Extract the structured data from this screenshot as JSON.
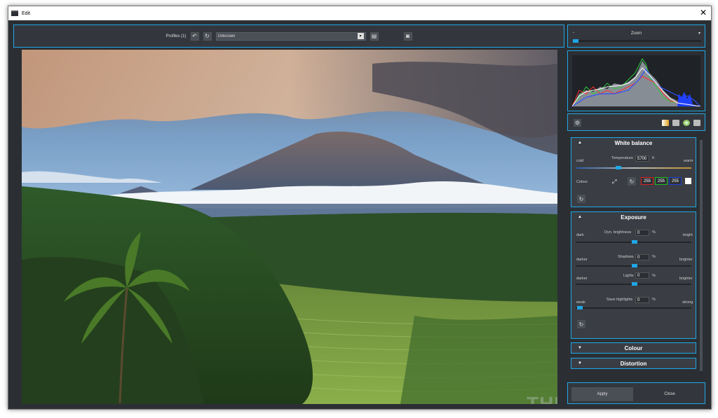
{
  "window": {
    "title": "Edit",
    "close": "✕"
  },
  "toolbar": {
    "profiles_label": "Profiles (1)",
    "undo": "↶",
    "reset": "↻",
    "profile_value": "Unknown",
    "dropdown_arrow": "▾",
    "save": "▤",
    "camera": "◙"
  },
  "zoom": {
    "label": "Zoom",
    "dash": "-",
    "arrow": "▾",
    "level": 0
  },
  "tools": {
    "gear": "⚙"
  },
  "white_balance": {
    "title": "White balance",
    "temperature_label": "Temperature",
    "temperature_value": "5700",
    "temperature_unit": "K",
    "cold": "cold",
    "warm": "warm",
    "colour_label": "Colour",
    "r": "255",
    "g": "255",
    "b": "255",
    "picker": "⤢",
    "reset": "↻"
  },
  "exposure": {
    "title": "Exposure",
    "dyn_label": "Dyn. brightness",
    "dyn_value": "0",
    "dyn_unit": "%",
    "dyn_left": "dark",
    "dyn_right": "bright",
    "shadows_label": "Shadows",
    "shadows_value": "0",
    "shadows_unit": "%",
    "shadows_left": "darker",
    "shadows_right": "brighter",
    "lights_label": "Lights",
    "lights_value": "0",
    "lights_unit": "%",
    "lights_left": "darker",
    "lights_right": "brighter",
    "save_label": "Save highlights",
    "save_value": "0",
    "save_unit": "%",
    "save_left": "weak",
    "save_right": "strong",
    "reset": "↻"
  },
  "colour": {
    "title": "Colour"
  },
  "distortion": {
    "title": "Distortion"
  },
  "watermark": "THESOFTWARE.SHOP",
  "buttons": {
    "apply": "Apply",
    "close": "Close"
  },
  "section_arrow": "▲",
  "section_arrow_down": "▼",
  "colors": {
    "accent": "#1fa7e6",
    "panel": "#33373d",
    "background": "#2b2f34"
  }
}
